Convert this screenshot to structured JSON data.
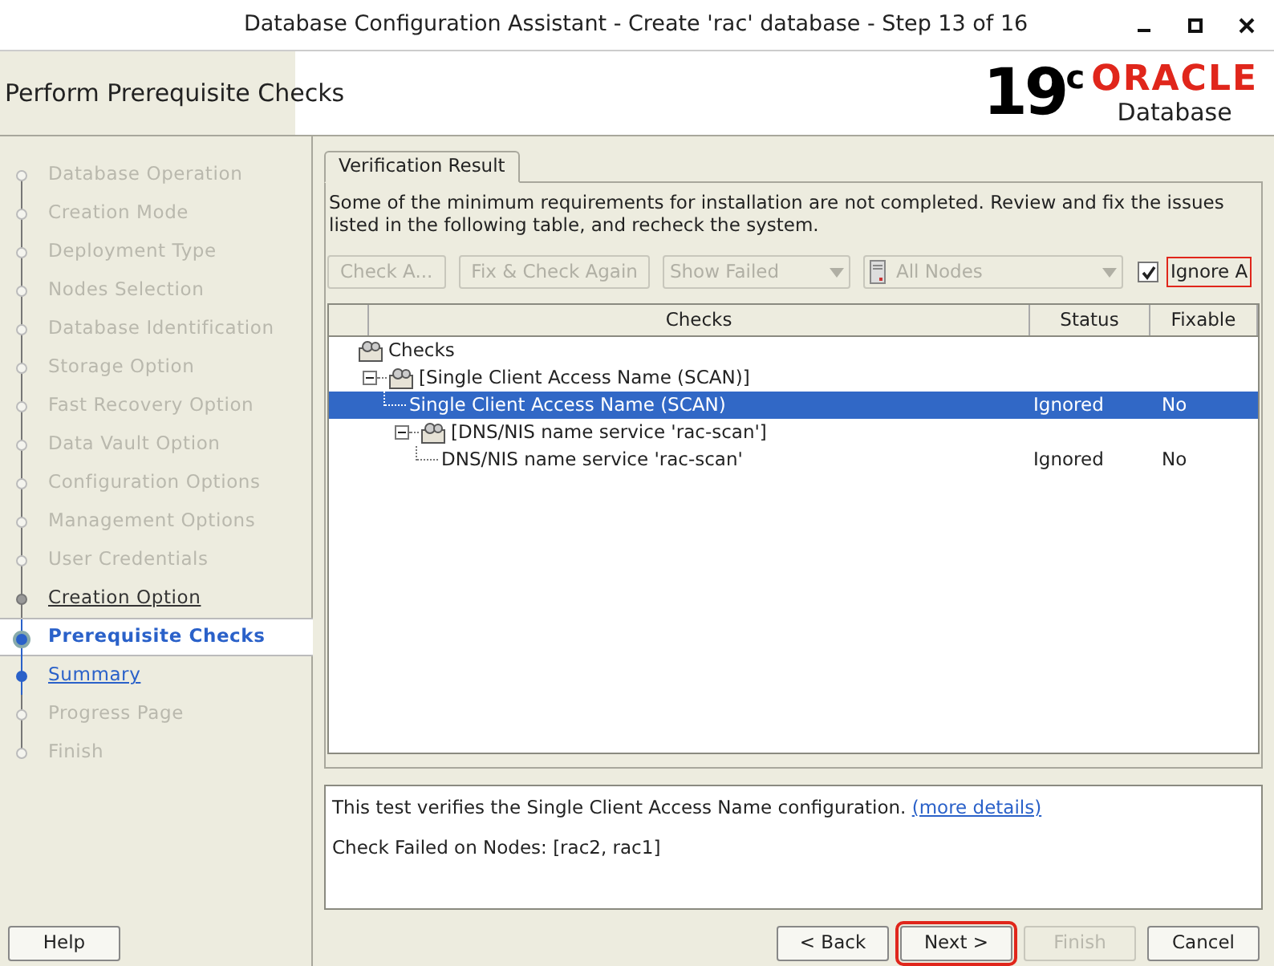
{
  "window": {
    "title": "Database Configuration Assistant - Create 'rac' database - Step 13 of 16"
  },
  "header": {
    "title": "Perform Prerequisite Checks",
    "logo": {
      "version": "19",
      "superscript": "c",
      "brand": "ORACLE",
      "product": "Database"
    }
  },
  "steps": [
    {
      "label": "Database Operation",
      "kind": "disabled"
    },
    {
      "label": "Creation Mode",
      "kind": "disabled"
    },
    {
      "label": "Deployment Type",
      "kind": "disabled"
    },
    {
      "label": "Nodes Selection",
      "kind": "disabled"
    },
    {
      "label": "Database Identification",
      "kind": "disabled"
    },
    {
      "label": "Storage Option",
      "kind": "disabled"
    },
    {
      "label": "Fast Recovery Option",
      "kind": "disabled"
    },
    {
      "label": "Data Vault Option",
      "kind": "disabled"
    },
    {
      "label": "Configuration Options",
      "kind": "disabled"
    },
    {
      "label": "Management Options",
      "kind": "disabled"
    },
    {
      "label": "User Credentials",
      "kind": "disabled"
    },
    {
      "label": "Creation Option",
      "kind": "visited"
    },
    {
      "label": "Prerequisite Checks",
      "kind": "current"
    },
    {
      "label": "Summary",
      "kind": "link"
    },
    {
      "label": "Progress Page",
      "kind": "disabled"
    },
    {
      "label": "Finish",
      "kind": "disabled"
    }
  ],
  "tabs": [
    {
      "label": "Verification Result",
      "selected": true
    }
  ],
  "description": "Some of the minimum requirements for installation are not completed. Review and fix the issues listed in the following table, and recheck the system.",
  "toolbar": {
    "buttons": [
      {
        "label": "Check A...",
        "disabled": true
      },
      {
        "label": "Fix & Check Again",
        "disabled": true
      }
    ],
    "filter": {
      "value": "Show Failed",
      "disabled": true
    },
    "nodes": {
      "value": "All Nodes",
      "disabled": true
    },
    "ignore": {
      "label": "Ignore A",
      "checked": true,
      "highlighted": true
    }
  },
  "table": {
    "columns": [
      "Checks",
      "Status",
      "Fixable"
    ],
    "tree": [
      {
        "label": "Checks",
        "kind": "group",
        "selected": false,
        "children": [
          {
            "label": "[Single Client Access Name (SCAN)]",
            "kind": "group",
            "expanded": true,
            "selected": false,
            "children": [
              {
                "label": "Single Client Access Name (SCAN)",
                "kind": "leaf",
                "status": "Ignored",
                "fixable": "No",
                "selected": true
              },
              {
                "label": "[DNS/NIS name service 'rac-scan']",
                "kind": "group",
                "expanded": true,
                "selected": false,
                "children": [
                  {
                    "label": "DNS/NIS name service 'rac-scan'",
                    "kind": "leaf",
                    "status": "Ignored",
                    "fixable": "No",
                    "selected": false
                  }
                ]
              }
            ]
          }
        ]
      }
    ]
  },
  "details": {
    "text": "This test verifies the Single Client Access Name configuration.",
    "link": "(more details)",
    "result": "Check Failed on Nodes: [rac2, rac1]"
  },
  "footer": {
    "help": {
      "label": "Help",
      "disabled": false
    },
    "buttons": [
      {
        "label": "< Back",
        "disabled": false,
        "highlighted": false
      },
      {
        "label": "Next >",
        "disabled": false,
        "highlighted": true
      },
      {
        "label": "Finish",
        "disabled": true,
        "highlighted": false
      },
      {
        "label": "Cancel",
        "disabled": false,
        "highlighted": false
      }
    ]
  }
}
